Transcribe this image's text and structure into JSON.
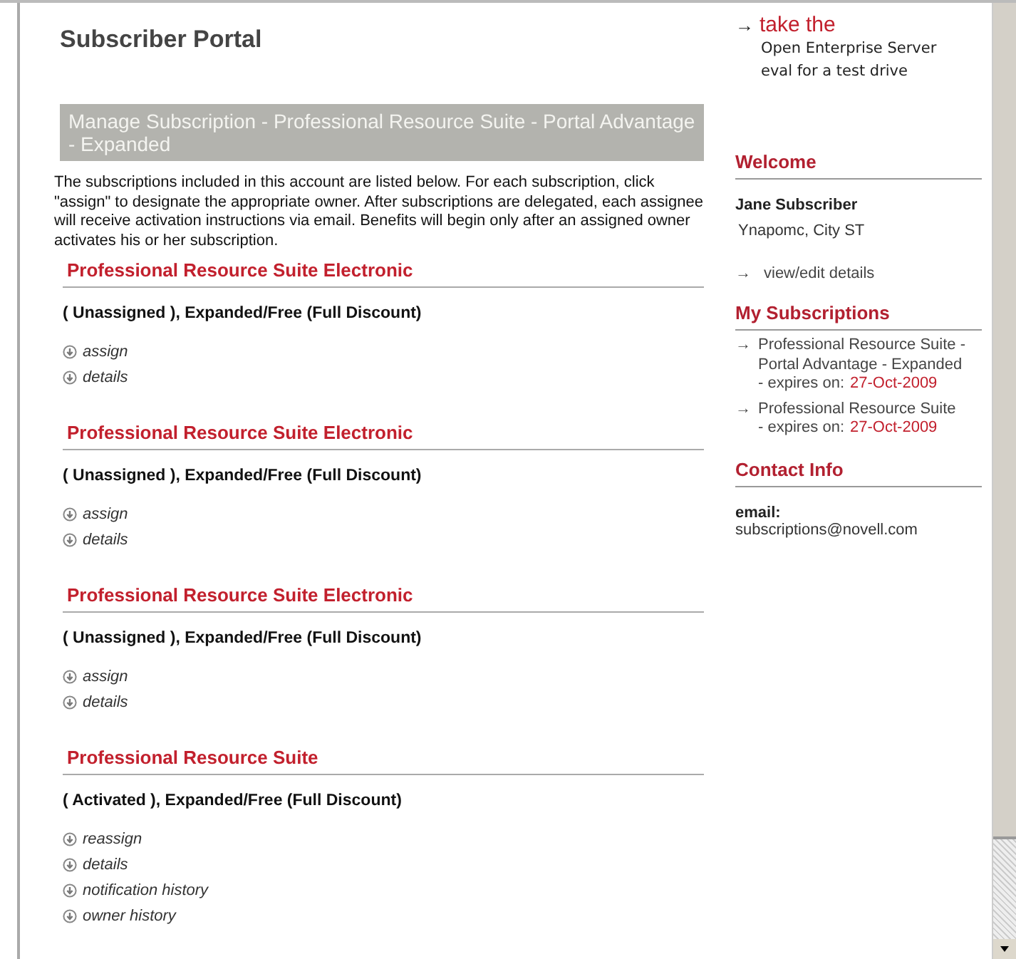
{
  "page_title": "Subscriber Portal",
  "banner": "Manage Subscription - Professional Resource Suite - Portal Advantage - Expanded",
  "intro": "The subscriptions included in this account are listed below. For each subscription, click \"assign\" to designate the appropriate owner. After subscriptions are delegated, each assignee will receive activation instructions via email. Benefits will begin only after an assigned owner activates his or her subscription.",
  "subscriptions": [
    {
      "name": "Professional Resource Suite Electronic",
      "status": "( Unassigned ), Expanded/Free (Full Discount)",
      "actions": [
        "assign",
        "details"
      ]
    },
    {
      "name": "Professional Resource Suite Electronic",
      "status": "( Unassigned ), Expanded/Free (Full Discount)",
      "actions": [
        "assign",
        "details"
      ]
    },
    {
      "name": "Professional Resource Suite Electronic",
      "status": "( Unassigned ), Expanded/Free (Full Discount)",
      "actions": [
        "assign",
        "details"
      ]
    },
    {
      "name": "Professional Resource Suite",
      "status": "( Activated ), Expanded/Free (Full Discount)",
      "actions": [
        "reassign",
        "details",
        "notification history",
        "owner history"
      ]
    }
  ],
  "sidebar": {
    "promo": {
      "arrow": "→",
      "headline": "take the",
      "text": "Open Enterprise Server eval for a test drive"
    },
    "welcome": {
      "heading": "Welcome",
      "name": "Jane Subscriber",
      "location": "Ynapomc, City ST",
      "arrow": "→",
      "link": "view/edit details"
    },
    "my_subscriptions": {
      "heading": "My Subscriptions",
      "items": [
        {
          "arrow": "→",
          "name": "Professional Resource Suite - Portal Advantage - Expanded",
          "expires_label": "- expires on:",
          "expires": "27-Oct-2009"
        },
        {
          "arrow": "→",
          "name": "Professional Resource Suite",
          "expires_label": "- expires on:",
          "expires": "27-Oct-2009"
        }
      ]
    },
    "contact": {
      "heading": "Contact Info",
      "label": "email:",
      "email": "subscriptions@novell.com"
    }
  }
}
